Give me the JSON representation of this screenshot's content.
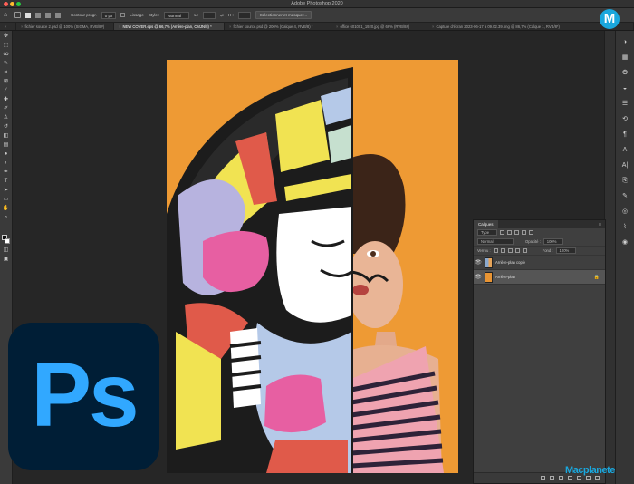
{
  "app": {
    "title": "Adobe Photoshop 2020"
  },
  "options": {
    "feather_label": "Contour progr.",
    "feather_value": "0 px",
    "antialias_label": "Lissage",
    "style_label": "Style :",
    "style_value": "Normal",
    "width_label": "L :",
    "height_label": "H :",
    "select_mask_label": "Sélectionner et masquer..."
  },
  "tabs": [
    {
      "label": "Sans titre-1 @ 33,3% (RVB/8)",
      "active": false
    },
    {
      "label": "fichier source 2.psd @ 100% (SIGMA, RVB/8#)",
      "active": false
    },
    {
      "label": "NEW COVER.eps @ 66,7% (Arrière-plan, CMJN/8) *",
      "active": true
    },
    {
      "label": "fichier source.psd @ 200% (Calque 4, RVB/8) *",
      "active": false
    },
    {
      "label": "office 601001_1920.jpg @ 66% (RVB/8#)",
      "active": false
    },
    {
      "label": "Capture d'écran 2023-06-17 à 09.02.39.png @ 86,7% (Calque 1, RVB/8*)",
      "active": false
    }
  ],
  "layers_panel": {
    "tab_label": "Calques",
    "kind_filter": "Type",
    "blend_mode": "Normal",
    "opacity_label": "Opacité :",
    "opacity_value": "100%",
    "lock_label": "Verrou :",
    "fill_label": "Fond :",
    "fill_value": "100%",
    "layers": [
      {
        "name": "Arrière-plan copie",
        "selected": false,
        "locked": false
      },
      {
        "name": "Arrière-plan",
        "selected": true,
        "locked": true
      }
    ]
  },
  "logo": {
    "text": "Ps"
  },
  "watermark": {
    "badge": "M",
    "text": "Macplanete"
  },
  "colors": {
    "ps_blue": "#31a8ff",
    "ps_navy": "#001e36",
    "canvas_orange": "#ee9a34",
    "macplanete_blue": "#1aa7dd"
  }
}
